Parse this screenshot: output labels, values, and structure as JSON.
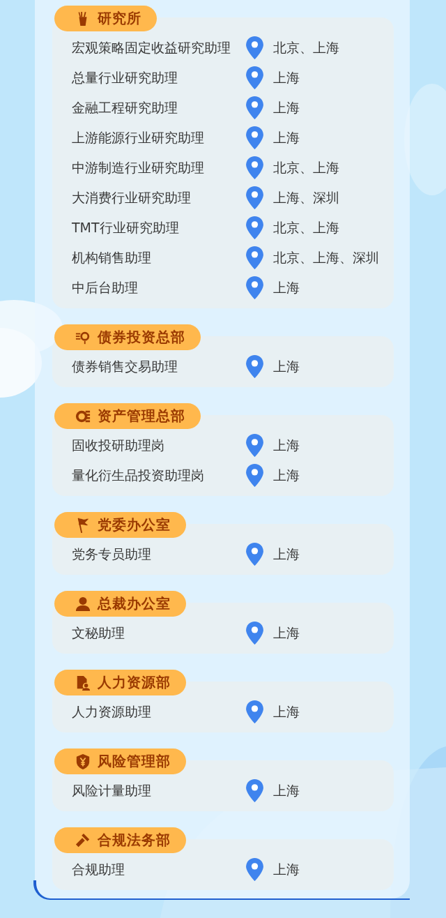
{
  "sections": [
    {
      "title": "研究所",
      "jobs": [
        {
          "position": "宏观策略固定收益研究助理",
          "location": "北京、上海"
        },
        {
          "position": "总量行业研究助理",
          "location": "上海"
        },
        {
          "position": "金融工程研究助理",
          "location": "上海"
        },
        {
          "position": "上游能源行业研究助理",
          "location": "上海"
        },
        {
          "position": "中游制造行业研究助理",
          "location": "北京、上海"
        },
        {
          "position": "大消费行业研究助理",
          "location": "上海、深圳"
        },
        {
          "position": "TMT行业研究助理",
          "location": "北京、上海"
        },
        {
          "position": "机构销售助理",
          "location": "北京、上海、深圳"
        },
        {
          "position": "中后台助理",
          "location": "上海"
        }
      ]
    },
    {
      "title": "债券投资总部",
      "jobs": [
        {
          "position": "债券销售交易助理",
          "location": "上海"
        }
      ]
    },
    {
      "title": "资产管理总部",
      "jobs": [
        {
          "position": "固收投研助理岗",
          "location": "上海"
        },
        {
          "position": "量化衍生品投资助理岗",
          "location": "上海"
        }
      ]
    },
    {
      "title": "党委办公室",
      "jobs": [
        {
          "position": "党务专员助理",
          "location": "上海"
        }
      ]
    },
    {
      "title": "总裁办公室",
      "jobs": [
        {
          "position": "文秘助理",
          "location": "上海"
        }
      ]
    },
    {
      "title": "人力资源部",
      "jobs": [
        {
          "position": "人力资源助理",
          "location": "上海"
        }
      ]
    },
    {
      "title": "风险管理部",
      "jobs": [
        {
          "position": "风险计量助理",
          "location": "上海"
        }
      ]
    },
    {
      "title": "合规法务部",
      "jobs": [
        {
          "position": "合规助理",
          "location": "上海"
        }
      ]
    }
  ]
}
